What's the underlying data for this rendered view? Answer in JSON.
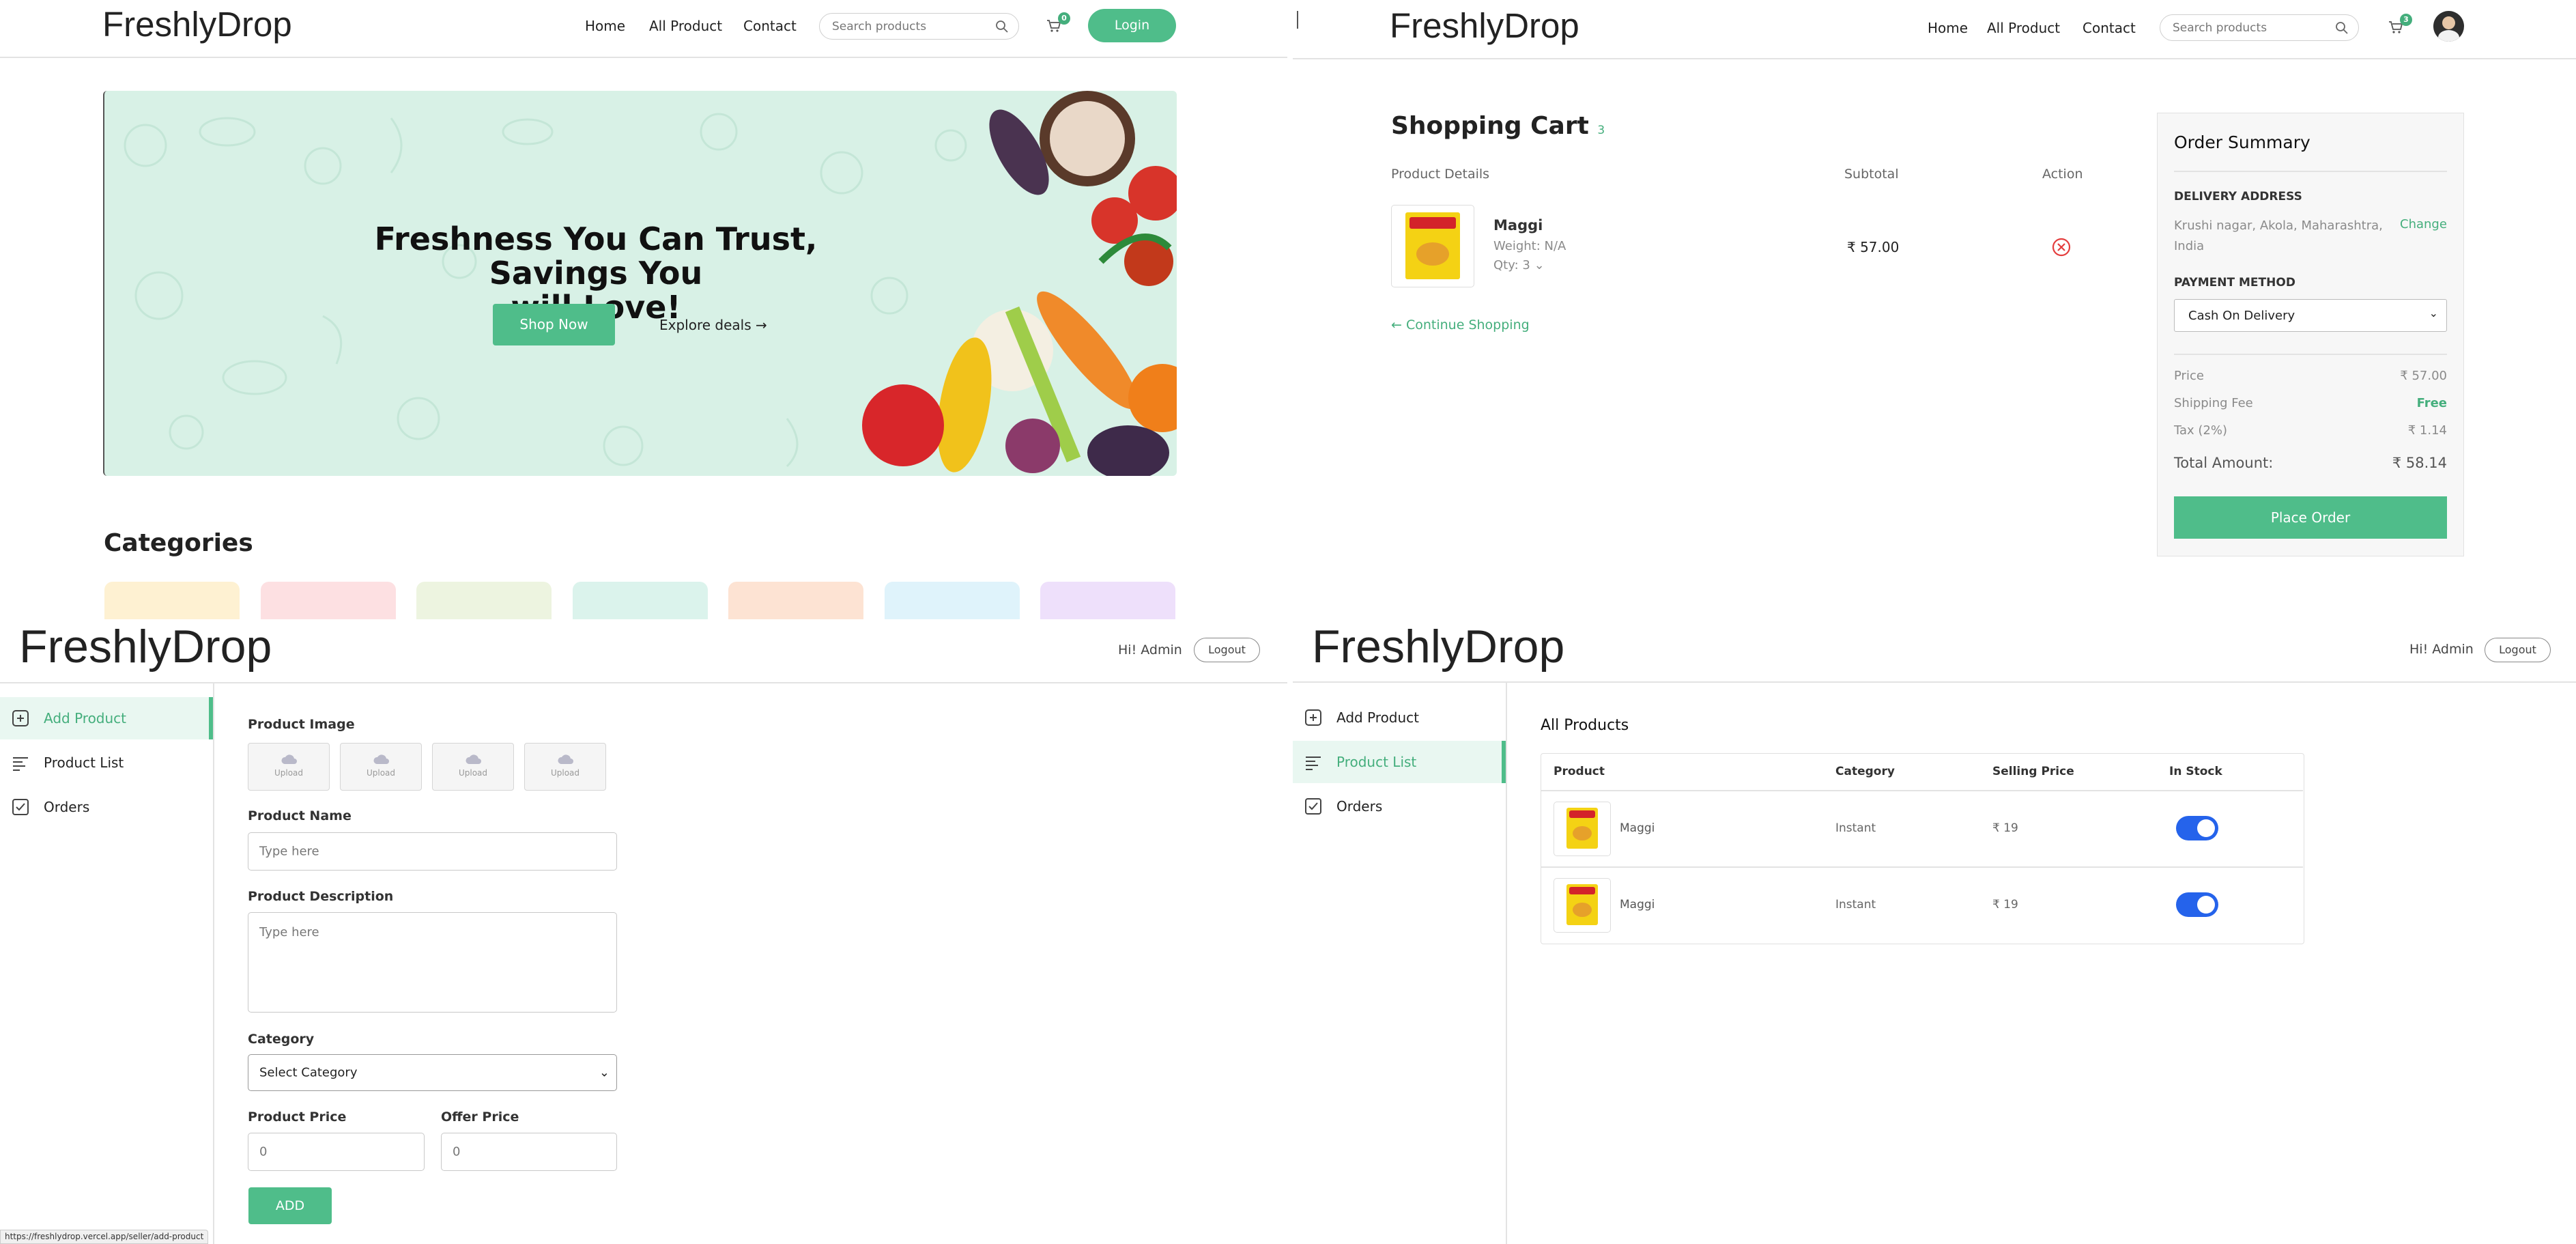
{
  "brand": "FreshlyDrop",
  "colors": {
    "accent": "#4fbd8a",
    "accent_dark": "#44ae7c",
    "hero_bg": "#d8f1e6",
    "toggle": "#2563eb",
    "remove": "#e43d3d"
  },
  "storefront": {
    "nav": [
      "Home",
      "All Product",
      "Contact"
    ],
    "search_placeholder": "Search products",
    "cart_count": "0",
    "login_label": "Login",
    "hero": {
      "line1": "Freshness You Can Trust, Savings You",
      "line2": "will Love!",
      "shop_now": "Shop Now",
      "explore": "Explore deals"
    },
    "categories_title": "Categories",
    "category_colors": [
      "#fef1d2",
      "#fde0e2",
      "#edf4e0",
      "#dbf3ec",
      "#fde3d3",
      "#dff3fb",
      "#eee0fb"
    ]
  },
  "cart": {
    "nav": [
      "Home",
      "All Product",
      "Contact"
    ],
    "search_placeholder": "Search products",
    "cart_count": "3",
    "title": "Shopping Cart",
    "count": "3",
    "headers": {
      "details": "Product Details",
      "subtotal": "Subtotal",
      "action": "Action"
    },
    "item": {
      "name": "Maggi",
      "weight": "Weight: N/A",
      "qty_label": "Qty:",
      "qty": "3",
      "subtotal": "₹ 57.00"
    },
    "continue": "Continue Shopping",
    "summary": {
      "title": "Order Summary",
      "address_label": "DELIVERY ADDRESS",
      "address_line1": "Krushi nagar, Akola, Maharashtra,",
      "address_line2": "India",
      "change": "Change",
      "payment_label": "PAYMENT METHOD",
      "payment_value": "Cash On Delivery",
      "price_label": "Price",
      "price": "₹ 57.00",
      "shipping_label": "Shipping Fee",
      "shipping": "Free",
      "tax_label": "Tax (2%)",
      "tax": "₹ 1.14",
      "total_label": "Total Amount:",
      "total": "₹ 58.14",
      "place_order": "Place Order"
    }
  },
  "seller": {
    "greeting": "Hi! Admin",
    "logout": "Logout",
    "sidebar": [
      "Add Product",
      "Product List",
      "Orders"
    ],
    "form": {
      "image_label": "Product Image",
      "upload": "Upload",
      "name_label": "Product Name",
      "name_placeholder": "Type here",
      "desc_label": "Product Description",
      "desc_placeholder": "Type here",
      "category_label": "Category",
      "category_value": "Select Category",
      "price_label": "Product Price",
      "price_placeholder": "0",
      "offer_label": "Offer Price",
      "offer_placeholder": "0",
      "add": "ADD"
    },
    "status_url": "https://freshlydrop.vercel.app/seller/add-product"
  },
  "product_list": {
    "title": "All Products",
    "headers": [
      "Product",
      "Category",
      "Selling Price",
      "In Stock"
    ],
    "rows": [
      {
        "name": "Maggi",
        "category": "Instant",
        "price": "₹ 19",
        "in_stock": true
      },
      {
        "name": "Maggi",
        "category": "Instant",
        "price": "₹ 19",
        "in_stock": true
      }
    ]
  }
}
